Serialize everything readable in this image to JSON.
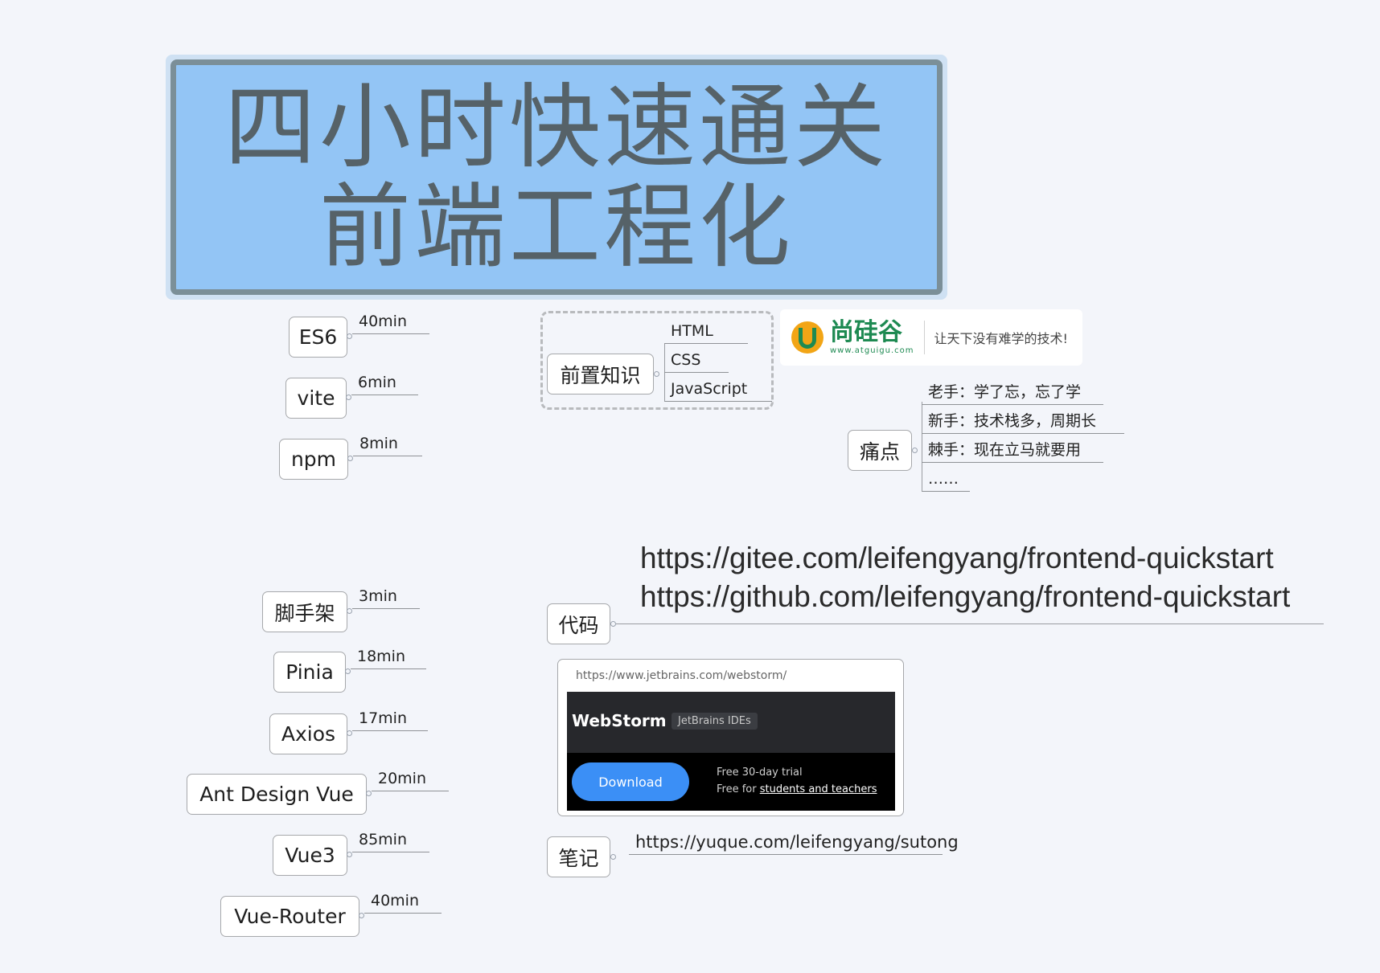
{
  "title": {
    "line1": "四小时快速通关",
    "line2": "前端工程化"
  },
  "left_topics": [
    {
      "name": "ES6",
      "duration": "40min"
    },
    {
      "name": "vite",
      "duration": "6min"
    },
    {
      "name": "npm",
      "duration": "8min"
    },
    {
      "name": "脚手架",
      "duration": "3min"
    },
    {
      "name": "Pinia",
      "duration": "18min"
    },
    {
      "name": "Axios",
      "duration": "17min"
    },
    {
      "name": "Ant Design Vue",
      "duration": "20min"
    },
    {
      "name": "Vue3",
      "duration": "85min"
    },
    {
      "name": "Vue-Router",
      "duration": "40min"
    }
  ],
  "prereq": {
    "label": "前置知识",
    "items": [
      "HTML",
      "CSS",
      "JavaScript"
    ]
  },
  "brand": {
    "name": "尚硅谷",
    "url": "www.atguigu.com",
    "slogan": "让天下没有难学的技术!"
  },
  "pain": {
    "label": "痛点",
    "items": [
      "老手：学了忘，忘了学",
      "新手：技术栈多，周期长",
      "棘手：现在立马就要用",
      "……"
    ]
  },
  "code": {
    "label": "代码",
    "urls": [
      "https://gitee.com/leifengyang/frontend-quickstart",
      "https://github.com/leifengyang/frontend-quickstart"
    ]
  },
  "webstorm": {
    "url": "https://www.jetbrains.com/webstorm/",
    "logo": "WebStorm",
    "badge": "JetBrains IDEs",
    "button": "Download",
    "note1": "Free 30-day trial",
    "note2_prefix": "Free for ",
    "note2_link": "students and teachers"
  },
  "notes": {
    "label": "笔记",
    "url": "https://yuque.com/leifengyang/sutong"
  }
}
